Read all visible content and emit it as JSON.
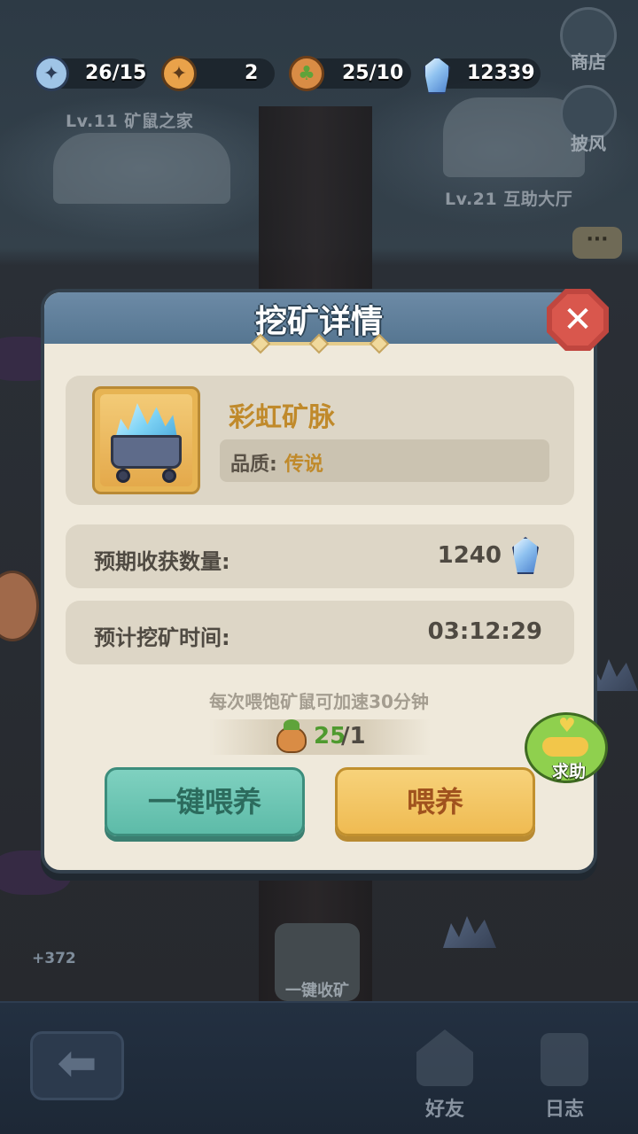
{
  "resources": {
    "compass_blue": {
      "icon": "compass-icon",
      "value": "26/15"
    },
    "compass_orange": {
      "icon": "compass-icon",
      "value": "2"
    },
    "carrot": {
      "icon": "carrot-basket-icon",
      "value": "25/10"
    },
    "gem": {
      "icon": "crystal-icon",
      "value": "12339"
    }
  },
  "buildings": {
    "left": "Lv.11 矿鼠之家",
    "right": "Lv.21 互助大厅"
  },
  "side_menu": {
    "shop": "商店",
    "cloak": "披风"
  },
  "chat": {
    "icon": "chat-bubble-icon",
    "text": "···"
  },
  "background": {
    "gain": "+372",
    "collect_all": "一键收矿"
  },
  "bottom_nav": {
    "back_icon": "arrow-left-icon",
    "friends": "好友",
    "log": "日志"
  },
  "modal": {
    "title": "挖矿详情",
    "mine": {
      "name": "彩虹矿脉",
      "quality_label": "品质:",
      "quality_value": "传说",
      "icon": "crystal-mine-cart-icon"
    },
    "expected_yield_label": "预期收获数量:",
    "expected_yield_value": "1240",
    "expected_time_label": "预计挖矿时间:",
    "expected_time_value": "03:12:29",
    "hint": "每次喂饱矿鼠可加速30分钟",
    "feed_current": "25",
    "feed_need": "/1",
    "btn_feed_all": "一键喂养",
    "btn_feed": "喂养",
    "help": "求助"
  },
  "colors": {
    "accent_gold": "#c08a2b",
    "green_button": "#5dbba8",
    "yellow_button": "#efbb52",
    "close_red": "#d9574d"
  }
}
